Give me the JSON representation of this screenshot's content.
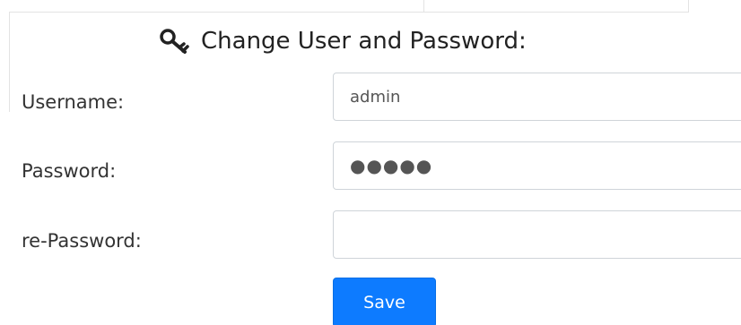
{
  "title": "Change User and Password:",
  "icons": {
    "title_icon": "key-icon"
  },
  "form": {
    "username": {
      "label": "Username:",
      "value": "admin"
    },
    "password": {
      "label": "Password:",
      "value": "●●●●●"
    },
    "repassword": {
      "label": "re-Password:",
      "value": ""
    },
    "save_label": "Save"
  },
  "colors": {
    "save_button": "#0d7bff"
  }
}
